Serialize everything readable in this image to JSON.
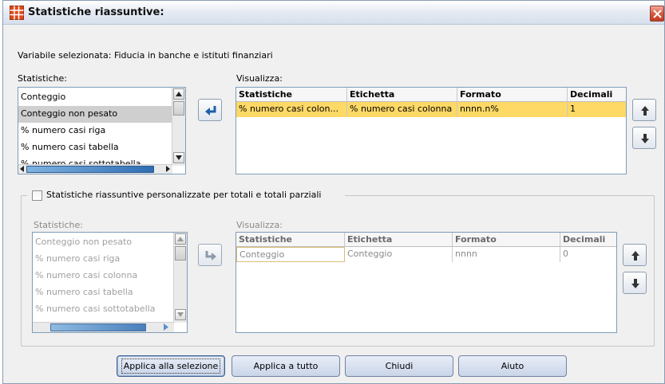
{
  "window": {
    "title": "Statistiche riassuntive:"
  },
  "selected_variable": "Variabile selezionata: Fiducia in banche e istituti finanziari",
  "top": {
    "stats_label": "Statistiche:",
    "stats_items": [
      {
        "label": "Conteggio",
        "selected": false
      },
      {
        "label": "Conteggio non pesato",
        "selected": true
      },
      {
        "label": "% numero casi riga",
        "selected": false
      },
      {
        "label": "% numero casi tabella",
        "selected": false
      },
      {
        "label": "% numero casi sottotabella",
        "selected": false
      }
    ],
    "display_label": "Visualizza:",
    "columns": [
      "Statistiche",
      "Etichetta",
      "Formato",
      "Decimali"
    ],
    "rows": [
      {
        "stat": "% numero casi colon...",
        "label": "% numero casi colonna",
        "format": "nnnn.n%",
        "decimals": "1"
      }
    ]
  },
  "custom": {
    "checkbox_label": "Statistiche riassuntive personalizzate per totali e totali parziali",
    "checked": false,
    "stats_label": "Statistiche:",
    "stats_items": [
      "Conteggio non pesato",
      "% numero casi riga",
      "% numero casi colonna",
      "% numero casi tabella",
      "% numero casi sottotabella"
    ],
    "display_label": "Visualizza:",
    "columns": [
      "Statistiche",
      "Etichetta",
      "Formato",
      "Decimali"
    ],
    "rows": [
      {
        "stat": "Conteggio",
        "label": "Conteggio",
        "format": "nnnn",
        "decimals": "0"
      }
    ]
  },
  "buttons": {
    "apply_selection": "Applica alla selezione",
    "apply_all": "Applica a tutto",
    "close": "Chiudi",
    "help": "Aiuto"
  },
  "colors": {
    "selected_row": "#ffd966",
    "accent": "#2f6db3",
    "title_icon": "#e04a1a"
  }
}
